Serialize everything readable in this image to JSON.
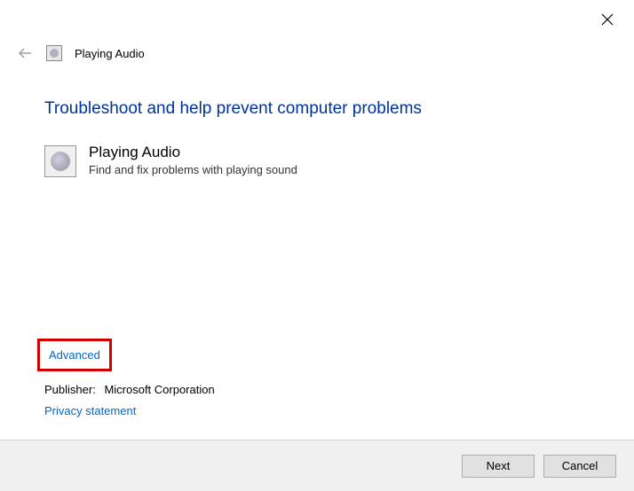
{
  "window": {
    "title": "Playing Audio"
  },
  "main": {
    "heading": "Troubleshoot and help prevent computer problems",
    "troubleshooter": {
      "title": "Playing Audio",
      "description": "Find and fix problems with playing sound"
    },
    "advanced_link": "Advanced",
    "publisher_label": "Publisher:",
    "publisher_value": "Microsoft Corporation",
    "privacy_link": "Privacy statement"
  },
  "footer": {
    "next_label": "Next",
    "cancel_label": "Cancel"
  }
}
